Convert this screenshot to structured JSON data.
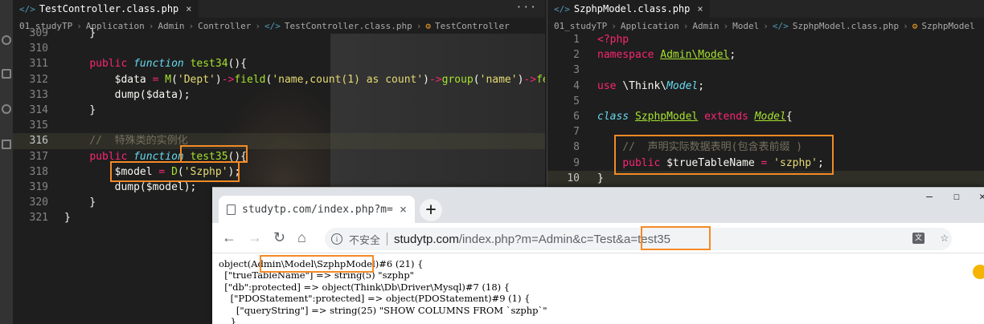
{
  "left_editor": {
    "tab_title": "TestController.class.php",
    "more_icon": "ellipsis-icon",
    "breadcrumb": [
      "01_studyTP",
      "Application",
      "Admin",
      "Controller",
      "TestController.class.php",
      "TestController"
    ],
    "lines": [
      {
        "n": "309",
        "text": "    }"
      },
      {
        "n": "310",
        "text": ""
      },
      {
        "n": "311",
        "text": "    public function test34(){"
      },
      {
        "n": "312",
        "text": "        $data = M('Dept')->field('name,count(1) as count')->group('name')->fe"
      },
      {
        "n": "313",
        "text": "        dump($data);"
      },
      {
        "n": "314",
        "text": "    }"
      },
      {
        "n": "315",
        "text": ""
      },
      {
        "n": "316",
        "text": "    //  特殊类的实例化"
      },
      {
        "n": "317",
        "text": "    public function test35(){"
      },
      {
        "n": "318",
        "text": "        $model = D('Szphp');"
      },
      {
        "n": "319",
        "text": "        dump($model);"
      },
      {
        "n": "320",
        "text": "    }"
      },
      {
        "n": "321",
        "text": "}"
      }
    ]
  },
  "right_editor": {
    "tab_title": "SzphpModel.class.php",
    "breadcrumb": [
      "01_studyTP",
      "Application",
      "Admin",
      "Model",
      "SzphpModel.class.php",
      "SzphpModel"
    ],
    "lines": [
      {
        "n": "1",
        "text": "<?php"
      },
      {
        "n": "2",
        "text": "namespace Admin\\Model;"
      },
      {
        "n": "3",
        "text": ""
      },
      {
        "n": "4",
        "text": "use \\Think\\Model;"
      },
      {
        "n": "5",
        "text": ""
      },
      {
        "n": "6",
        "text": "class SzphpModel extends Model{"
      },
      {
        "n": "7",
        "text": ""
      },
      {
        "n": "8",
        "text": "    //  声明实际数据表明(包含表前缀 )"
      },
      {
        "n": "9",
        "text": "    public $trueTableName = 'szphp';"
      },
      {
        "n": "10",
        "text": "}"
      }
    ]
  },
  "browser": {
    "tab_title": "studytp.com/index.php?m=Ad",
    "new_tab": "+",
    "window_controls": [
      "—",
      "☐",
      "✕"
    ],
    "back": "←",
    "forward": "→",
    "reload": "↻",
    "home": "⌂",
    "not_secure": "不安全",
    "url_host": "studytp.com",
    "url_path": "/index.php?m=Admin&c=Test&a=test35",
    "translate_icon": "translate-icon",
    "star_icon": "star-icon",
    "output_lines": [
      "object(Admin\\Model\\SzphpModel)#6 (21) {",
      "  [\"trueTableName\"] => string(5) \"szphp\"",
      "  [\"db\":protected] => object(Think\\Db\\Driver\\Mysql)#7 (18) {",
      "    [\"PDOStatement\":protected] => object(PDOStatement)#9 (1) {",
      "      [\"queryString\"] => string(25) \"SHOW COLUMNS FROM `szphp`\"",
      "    }"
    ]
  },
  "colors": {
    "highlight": "#f38a26",
    "editor_bg": "#1e1e1e"
  }
}
